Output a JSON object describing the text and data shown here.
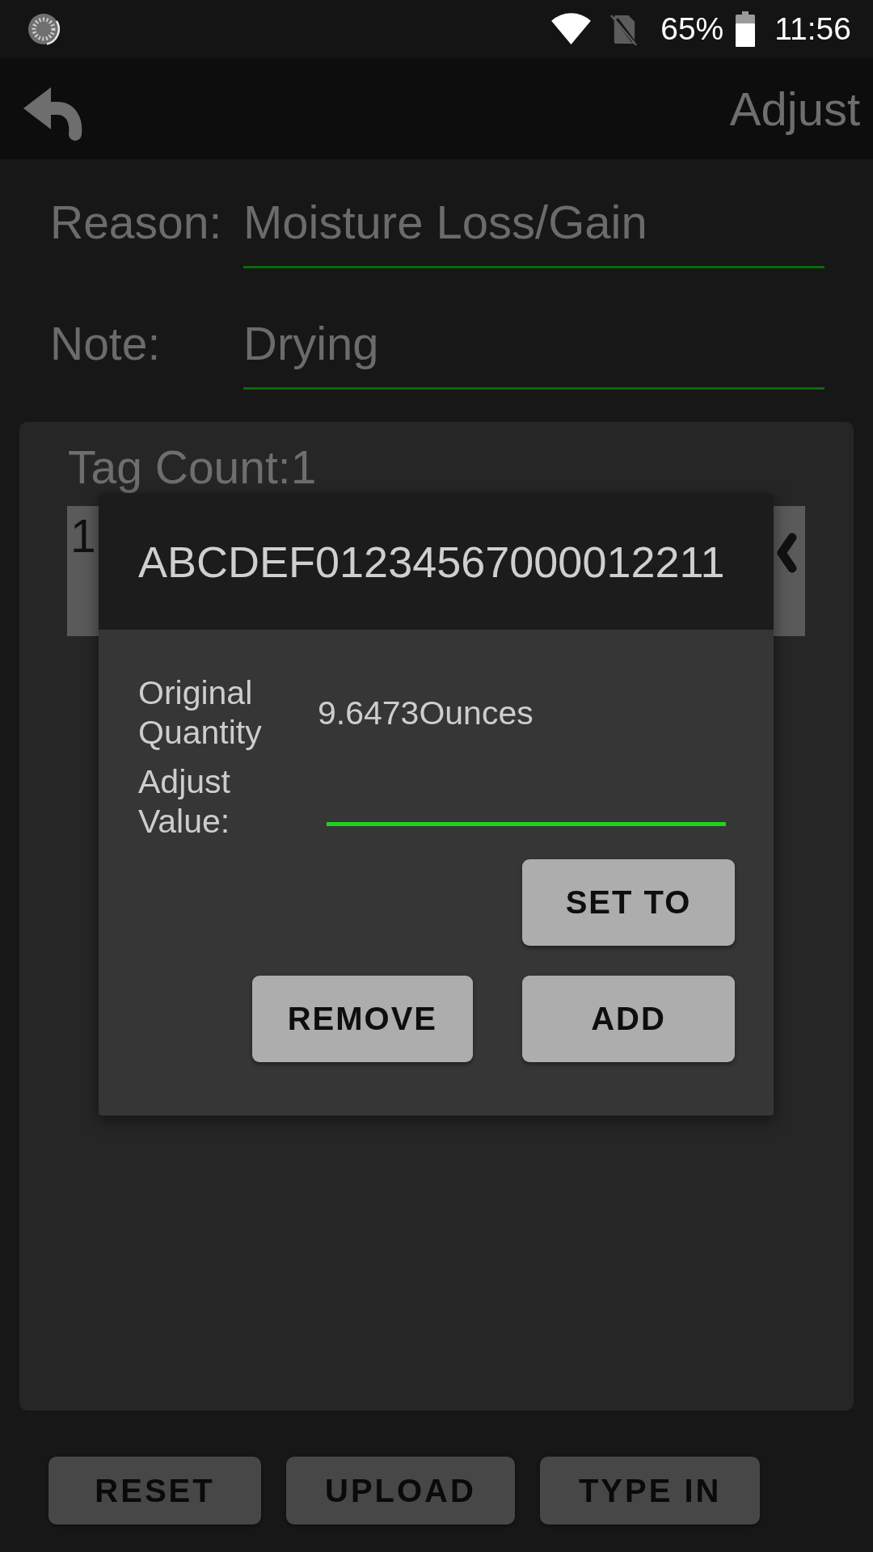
{
  "status_bar": {
    "battery": "65%",
    "time": "11:56"
  },
  "toolbar": {
    "title": "Adjust"
  },
  "form": {
    "fields": [
      {
        "label": "Reason:",
        "value": "Moisture Loss/Gain"
      },
      {
        "label": "Note:",
        "value": "Drying"
      }
    ]
  },
  "tag_panel": {
    "count": "Tag Count:1",
    "rows": [
      {
        "text": "1"
      }
    ]
  },
  "dialog": {
    "title": "ABCDEF01234567000012211",
    "quantity": {
      "label": "Original Quantity",
      "value": "9.6473Ounces"
    },
    "adjust": {
      "label": "Adjust Value:"
    },
    "button_rows": [
      [
        "SET TO"
      ],
      [
        "REMOVE",
        "ADD"
      ]
    ]
  },
  "bottom_buttons": [
    "RESET",
    "UPLOAD",
    "TYPE IN"
  ]
}
